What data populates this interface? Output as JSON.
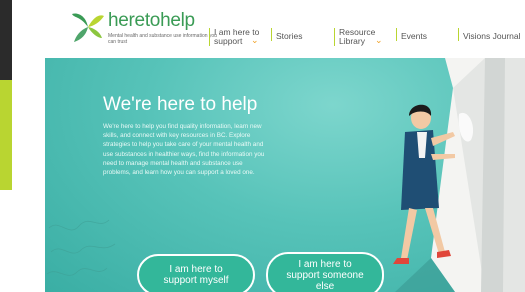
{
  "logo": {
    "wordmark": "heretohelp",
    "tagline": "Mental health and substance use information you can trust"
  },
  "nav": {
    "items": [
      {
        "label_1": "I am here to",
        "label_2": "support"
      },
      {
        "label": "Stories"
      },
      {
        "label_1": "Resource",
        "label_2": "Library"
      },
      {
        "label": "Events"
      },
      {
        "label": "Visions Journal"
      }
    ]
  },
  "hero": {
    "title": "We're here to help",
    "body": "We're here to help you find quality information, learn new skills, and connect with key resources in BC. Explore strategies to help you take care of your mental health and use substances in healthier ways, find the information you need to manage mental health and substance use problems, and learn how you can support a loved one."
  },
  "cta": {
    "myself_1": "I am here to",
    "myself_2": "support myself",
    "else_1": "I am here to",
    "else_2": "support someone",
    "else_3": "else"
  },
  "colors": {
    "accent_green": "#3a9b55",
    "lime": "#b9d531",
    "teal": "#4fc0b7",
    "chevron": "#f0a020"
  }
}
